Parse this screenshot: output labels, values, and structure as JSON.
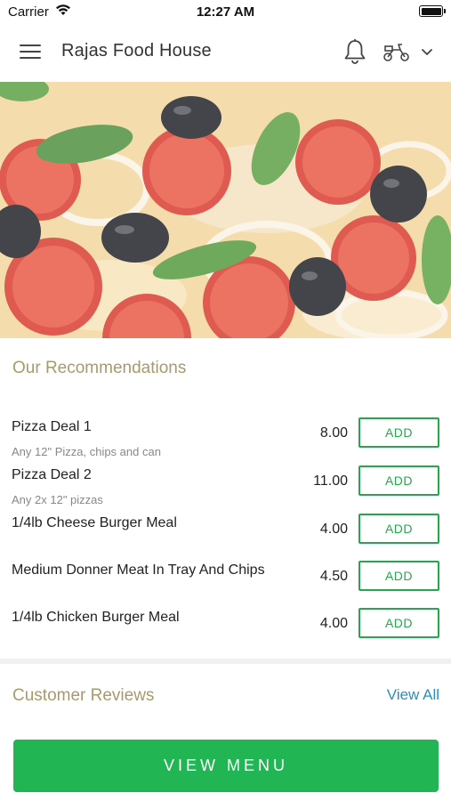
{
  "status_bar": {
    "carrier": "Carrier",
    "time": "12:27 AM"
  },
  "header": {
    "title": "Rajas Food House",
    "icons": [
      "menu-icon",
      "bell-icon",
      "scooter-icon",
      "chevron-down-icon"
    ]
  },
  "hero": {
    "image": "pizza-photo"
  },
  "recommendations": {
    "title": "Our Recommendations",
    "items": [
      {
        "name": "Pizza Deal 1",
        "description": "Any 12\" Pizza, chips and can",
        "price": "8.00",
        "button": "ADD"
      },
      {
        "name": "Pizza Deal 2",
        "description": "Any 2x 12\" pizzas",
        "price": "11.00",
        "button": "ADD"
      },
      {
        "name": "1/4lb Cheese Burger Meal",
        "description": "",
        "price": "4.00",
        "button": "ADD"
      },
      {
        "name": "Medium Donner Meat In Tray And Chips",
        "description": "",
        "price": "4.50",
        "button": "ADD"
      },
      {
        "name": "1/4lb Chicken Burger Meal",
        "description": "",
        "price": "4.00",
        "button": "ADD"
      }
    ]
  },
  "reviews": {
    "title": "Customer Reviews",
    "view_all": "View All"
  },
  "footer": {
    "view_menu": "VIEW MENU"
  },
  "colors": {
    "accent_green": "#22b553",
    "section_title": "#a89a6b",
    "link_blue": "#2a8fbd"
  }
}
